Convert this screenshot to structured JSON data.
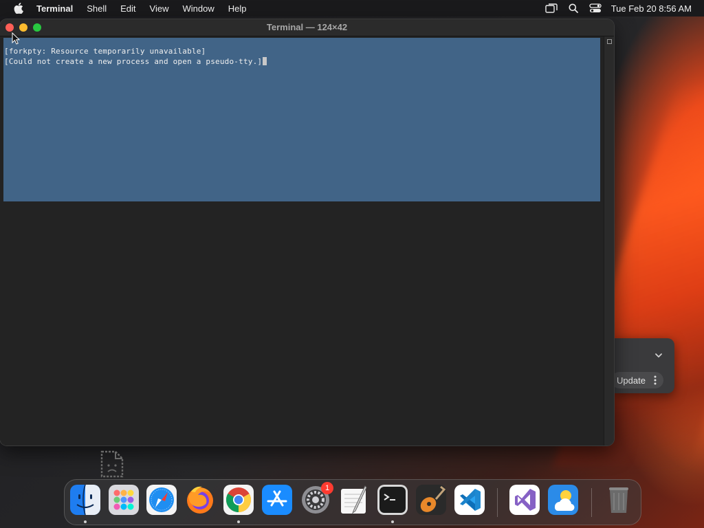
{
  "menubar": {
    "app_name": "Terminal",
    "items": [
      "Shell",
      "Edit",
      "View",
      "Window",
      "Help"
    ],
    "clock": "Tue Feb 20  8:56 AM"
  },
  "terminal": {
    "title": "Terminal — 124×42",
    "lines": [
      "[forkpty: Resource temporarily unavailable]",
      "[Could not create a new process and open a pseudo-tty.]"
    ]
  },
  "notification": {
    "update_label": "Update"
  },
  "dock": {
    "apps": [
      {
        "name": "Finder",
        "running": true
      },
      {
        "name": "Launchpad",
        "running": false
      },
      {
        "name": "Safari",
        "running": false
      },
      {
        "name": "Firefox",
        "running": false
      },
      {
        "name": "Google Chrome",
        "running": true
      },
      {
        "name": "App Store",
        "running": false
      },
      {
        "name": "System Settings",
        "running": false,
        "badge": "1"
      },
      {
        "name": "TextEdit",
        "running": false
      },
      {
        "name": "Terminal",
        "running": true
      },
      {
        "name": "GarageBand",
        "running": false
      },
      {
        "name": "Visual Studio Code",
        "running": false
      },
      {
        "name": "Visual Studio",
        "running": false
      },
      {
        "name": "Weather",
        "running": false
      },
      {
        "name": "Trash",
        "running": false
      }
    ]
  },
  "colors": {
    "selection": "#416487",
    "terminal_bg": "#232323",
    "close": "#ff5f57",
    "minimize": "#febc2e",
    "maximize": "#28c840"
  }
}
